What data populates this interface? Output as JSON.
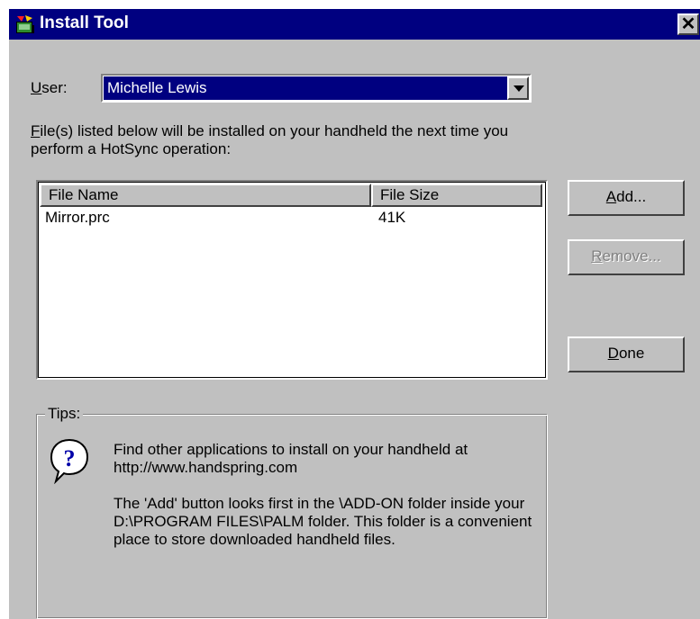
{
  "window": {
    "title": "Install Tool",
    "close_glyph": "✕"
  },
  "user": {
    "label": "User:",
    "selected": "Michelle Lewis"
  },
  "description": "File(s) listed below will be installed on your handheld the next time you perform a HotSync operation:",
  "file_list": {
    "columns": [
      "File Name",
      "File Size"
    ],
    "rows": [
      {
        "name": "Mirror.prc",
        "size": "41K"
      }
    ]
  },
  "buttons": {
    "add": "Add...",
    "remove": "Remove...",
    "done": "Done"
  },
  "tips": {
    "legend": "Tips:",
    "icon": "question-balloon-icon",
    "paragraph1": "Find other applications to install on your handheld at http://www.handspring.com",
    "paragraph2": "The 'Add' button looks first in the \\ADD-ON folder inside your D:\\PROGRAM FILES\\PALM folder. This folder is a convenient place to store downloaded handheld files."
  },
  "colors": {
    "titlebar": "#000080",
    "face": "#c0c0c0",
    "selection": "#000080"
  }
}
